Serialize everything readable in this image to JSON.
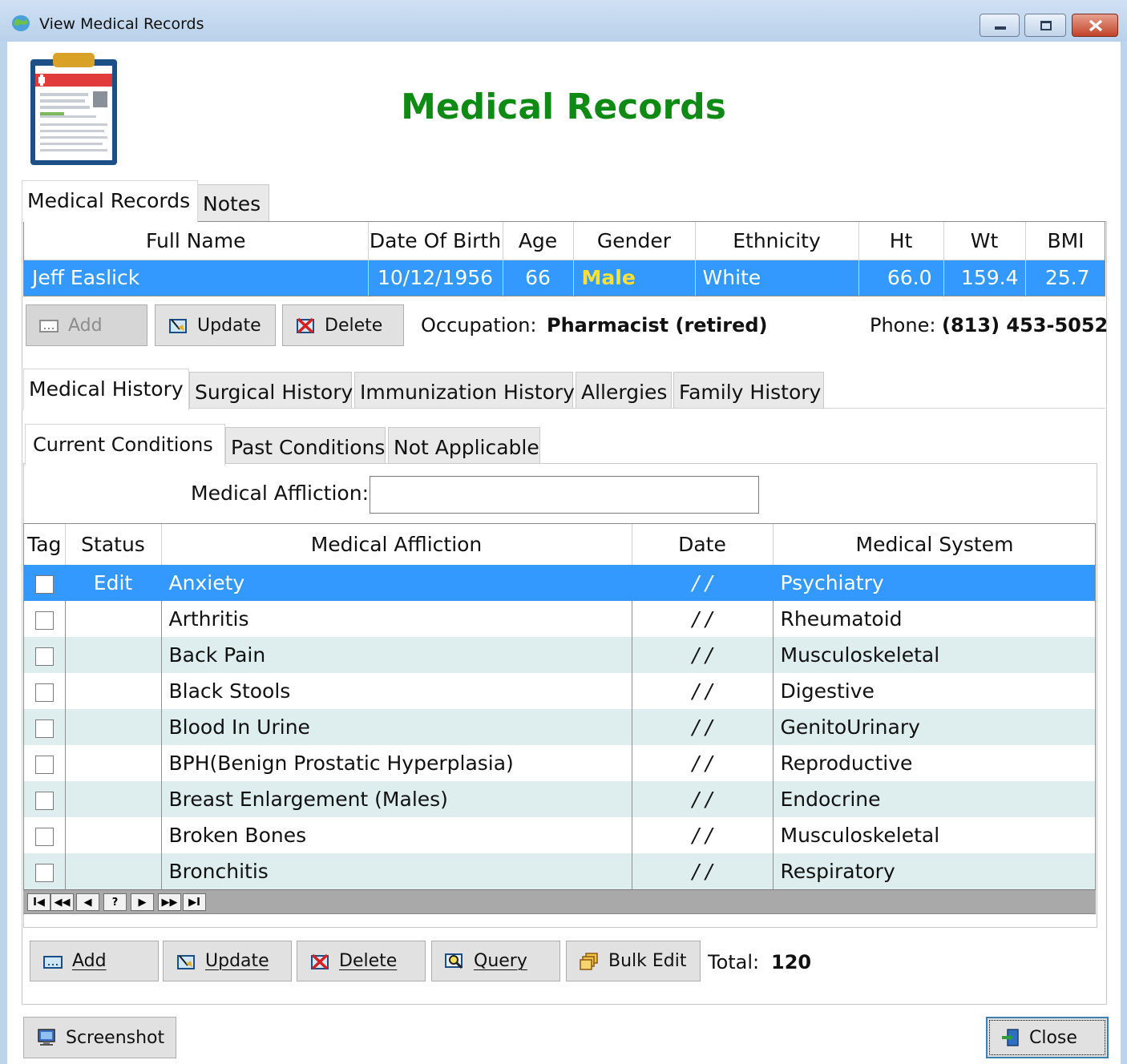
{
  "window": {
    "title": "View Medical Records",
    "heading": "Medical Records"
  },
  "top_tabs": [
    "Medical Records",
    "Notes"
  ],
  "patient_grid": {
    "columns": [
      "Full Name",
      "Date Of Birth",
      "Age",
      "Gender",
      "Ethnicity",
      "Ht",
      "Wt",
      "BMI"
    ],
    "row": {
      "full_name": "Jeff Easlick",
      "dob": "10/12/1956",
      "age": "66",
      "gender": "Male",
      "ethnicity": "White",
      "ht": "66.0",
      "wt": "159.4",
      "bmi": "25.7"
    }
  },
  "patient_buttons": {
    "add": "Add",
    "update": "Update",
    "delete": "Delete"
  },
  "occupation": {
    "label": "Occupation:",
    "value": "Pharmacist (retired)"
  },
  "phone": {
    "label": "Phone:",
    "value": "(813) 453-5052"
  },
  "history_tabs": [
    "Medical History",
    "Surgical History",
    "Immunization History",
    "Allergies",
    "Family History"
  ],
  "condition_tabs": [
    "Current Conditions",
    "Past Conditions",
    "Not Applicable"
  ],
  "filter": {
    "label": "Medical Affliction:",
    "value": ""
  },
  "conditions_grid": {
    "columns": [
      "Tag",
      "Status",
      "Medical Affliction",
      "Date",
      "Medical System"
    ],
    "rows": [
      {
        "status": "Edit",
        "affliction": "Anxiety",
        "date": "/ /",
        "system": "Psychiatry"
      },
      {
        "status": "",
        "affliction": "Arthritis",
        "date": "/ /",
        "system": "Rheumatoid"
      },
      {
        "status": "",
        "affliction": "Back Pain",
        "date": "/ /",
        "system": "Musculoskeletal"
      },
      {
        "status": "",
        "affliction": "Black Stools",
        "date": "/ /",
        "system": "Digestive"
      },
      {
        "status": "",
        "affliction": "Blood In Urine",
        "date": "/ /",
        "system": "GenitoUrinary"
      },
      {
        "status": "",
        "affliction": "BPH(Benign Prostatic Hyperplasia)",
        "date": "/ /",
        "system": "Reproductive"
      },
      {
        "status": "",
        "affliction": "Breast Enlargement (Males)",
        "date": "/ /",
        "system": "Endocrine"
      },
      {
        "status": "",
        "affliction": "Broken Bones",
        "date": "/ /",
        "system": "Musculoskeletal"
      },
      {
        "status": "",
        "affliction": "Bronchitis",
        "date": "/ /",
        "system": "Respiratory"
      }
    ]
  },
  "navigator": [
    "I◀",
    "◀◀",
    "◀",
    "?",
    "▶",
    "▶▶",
    "▶I"
  ],
  "bottom_buttons": {
    "add": "Add",
    "update": "Update",
    "delete": "Delete",
    "query": "Query",
    "bulk_edit": "Bulk Edit"
  },
  "total": {
    "label": "Total:",
    "value": "120"
  },
  "footer": {
    "screenshot": "Screenshot",
    "close": "Close"
  },
  "colors": {
    "heading": "#0f8a14",
    "selection": "#3399ff",
    "gender_highlight": "#ffe135",
    "alt_row": "#deeeee"
  }
}
